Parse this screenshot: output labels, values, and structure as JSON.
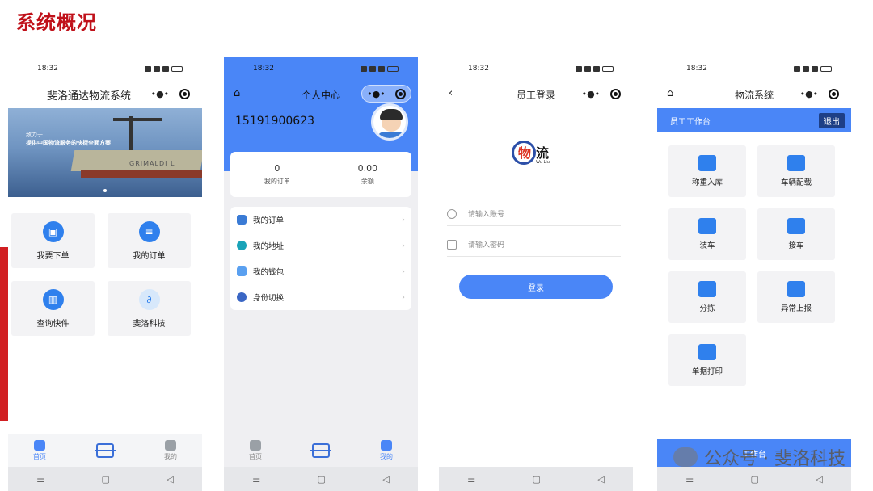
{
  "slide": {
    "title": "系统概况"
  },
  "status": {
    "time": "18:32"
  },
  "phone1": {
    "title": "斐洛通达物流系统",
    "banner": {
      "line1": "致力于",
      "line2": "提供中国物流服务的快捷全面方案",
      "ship": "GRIMALDI L"
    },
    "cards": [
      {
        "label": "我要下单",
        "icon": "order-icon"
      },
      {
        "label": "我的订单",
        "icon": "list-icon"
      },
      {
        "label": "查询快件",
        "icon": "barcode-icon"
      },
      {
        "label": "斐洛科技",
        "icon": "link-icon"
      }
    ],
    "tabs": [
      {
        "label": "首页",
        "icon": "home-icon"
      },
      {
        "label": "",
        "icon": "scan-icon"
      },
      {
        "label": "我的",
        "icon": "user-icon"
      }
    ]
  },
  "phone2": {
    "title": "个人中心",
    "phone": "15191900623",
    "stats": [
      {
        "value": "0",
        "label": "我的订单"
      },
      {
        "value": "0.00",
        "label": "余额"
      }
    ],
    "menu": [
      {
        "label": "我的订单",
        "icon": "order-icon"
      },
      {
        "label": "我的地址",
        "icon": "location-icon"
      },
      {
        "label": "我的钱包",
        "icon": "wallet-icon"
      },
      {
        "label": "身份切换",
        "icon": "user-switch-icon"
      }
    ],
    "tabs": [
      {
        "label": "首页"
      },
      {
        "label": ""
      },
      {
        "label": "我的"
      }
    ]
  },
  "phone3": {
    "title": "员工登录",
    "logo": {
      "char1": "物",
      "char2": "流",
      "sub": "Wu Liu"
    },
    "account_placeholder": "请输入账号",
    "password_placeholder": "请输入密码",
    "login_label": "登录"
  },
  "phone4": {
    "title": "物流系统",
    "workbench": "员工工作台",
    "logout": "退出",
    "cards": [
      {
        "label": "称重入库",
        "icon": "scale-icon"
      },
      {
        "label": "车辆配载",
        "icon": "vehicle-load-icon"
      },
      {
        "label": "装车",
        "icon": "loading-icon"
      },
      {
        "label": "接车",
        "icon": "truck-icon"
      },
      {
        "label": "分拣",
        "icon": "sort-icon"
      },
      {
        "label": "异常上报",
        "icon": "alert-icon"
      },
      {
        "label": "单据打印",
        "icon": "printer-icon"
      }
    ],
    "footer": "工作台"
  },
  "watermark": "公众号 · 斐洛科技"
}
